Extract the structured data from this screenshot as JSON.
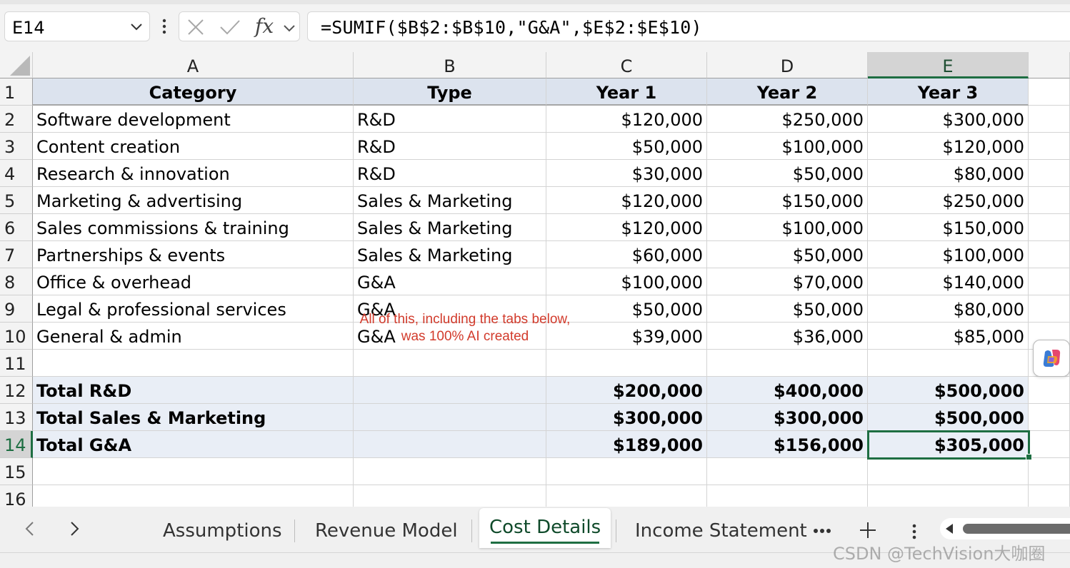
{
  "formula_bar": {
    "cell_reference": "E14",
    "formula": "=SUMIF($B$2:$B$10,\"G&A\",$E$2:$E$10)",
    "fx_label": "fx"
  },
  "sheet": {
    "columns": [
      "A",
      "B",
      "C",
      "D",
      "E"
    ],
    "selected_column": "E",
    "selected_row": 14,
    "rows": [
      {
        "num": "1",
        "cells": [
          "Category",
          "Type",
          "Year 1",
          "Year 2",
          "Year 3"
        ]
      },
      {
        "num": "2",
        "cells": [
          "Software development",
          "R&D",
          "$120,000",
          "$250,000",
          "$300,000"
        ]
      },
      {
        "num": "3",
        "cells": [
          "Content creation",
          "R&D",
          "$50,000",
          "$100,000",
          "$120,000"
        ]
      },
      {
        "num": "4",
        "cells": [
          "Research & innovation",
          "R&D",
          "$30,000",
          "$50,000",
          "$80,000"
        ]
      },
      {
        "num": "5",
        "cells": [
          "Marketing & advertising",
          "Sales & Marketing",
          "$120,000",
          "$150,000",
          "$250,000"
        ]
      },
      {
        "num": "6",
        "cells": [
          "Sales commissions & training",
          "Sales & Marketing",
          "$120,000",
          "$100,000",
          "$150,000"
        ]
      },
      {
        "num": "7",
        "cells": [
          "Partnerships & events",
          "Sales & Marketing",
          "$60,000",
          "$50,000",
          "$100,000"
        ]
      },
      {
        "num": "8",
        "cells": [
          "Office & overhead",
          "G&A",
          "$100,000",
          "$70,000",
          "$140,000"
        ]
      },
      {
        "num": "9",
        "cells": [
          "Legal & professional services",
          "G&A",
          "$50,000",
          "$50,000",
          "$80,000"
        ]
      },
      {
        "num": "10",
        "cells": [
          "General & admin",
          "G&A",
          "$39,000",
          "$36,000",
          "$85,000"
        ]
      },
      {
        "num": "11",
        "cells": [
          "",
          "",
          "",
          "",
          ""
        ]
      },
      {
        "num": "12",
        "cells": [
          "Total R&D",
          "",
          "$200,000",
          "$400,000",
          "$500,000"
        ]
      },
      {
        "num": "13",
        "cells": [
          "Total Sales & Marketing",
          "",
          "$300,000",
          "$300,000",
          "$500,000"
        ]
      },
      {
        "num": "14",
        "cells": [
          "Total G&A",
          "",
          "$189,000",
          "$156,000",
          "$305,000"
        ]
      },
      {
        "num": "15",
        "cells": [
          "",
          "",
          "",
          "",
          ""
        ]
      },
      {
        "num": "16",
        "cells": [
          "",
          "",
          "",
          "",
          ""
        ]
      }
    ]
  },
  "annotation": {
    "line1": "All of this, including the tabs below,",
    "line2": "was 100% AI created",
    "color": "#d23b2c"
  },
  "tabs": {
    "items": [
      {
        "label": "Assumptions",
        "active": false
      },
      {
        "label": "Revenue Model",
        "active": false
      },
      {
        "label": "Cost Details",
        "active": true
      },
      {
        "label": "Income Statement",
        "active": false
      }
    ]
  },
  "watermark": "CSDN @TechVision大咖圈",
  "icons": {
    "name_box_dropdown": "chevron-down-icon",
    "more_options": "vertical-ellipsis-icon",
    "cancel": "close-icon",
    "enter": "checkmark-icon",
    "insert_function": "fx-icon",
    "previous_sheet": "chevron-left-icon",
    "next_sheet": "chevron-right-icon",
    "more_sheets": "horizontal-ellipsis-icon",
    "add_sheet": "plus-icon",
    "sheet_options": "vertical-ellipsis-icon",
    "copilot": "copilot-icon"
  },
  "colors": {
    "accent_green": "#1e6e42",
    "header_fill": "#dce3ee",
    "total_fill": "#e9eef6"
  }
}
